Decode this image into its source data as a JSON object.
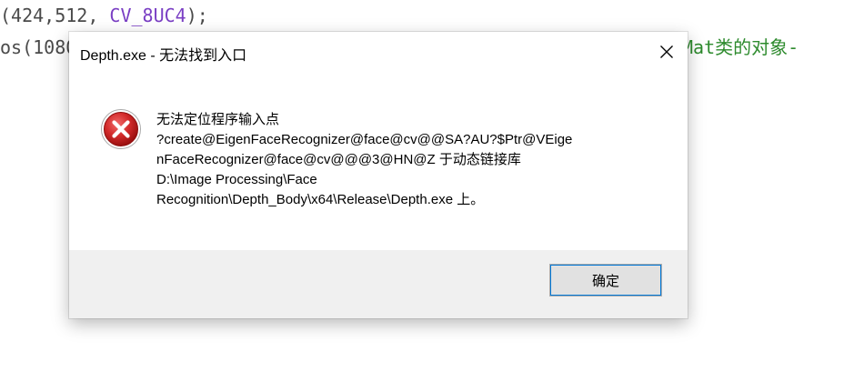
{
  "editor": {
    "line1_prefix": "(424,512, ",
    "line1_keyword": "CV_8UC4",
    "line1_suffix": ");",
    "line2_text": "os(1080",
    "line2_comment": "化Mat类的对象-"
  },
  "dialog": {
    "title": "Depth.exe - 无法找到入口",
    "close_glyph": "✕",
    "icon": "error-icon",
    "message_lines": [
      "无法定位程序输入点",
      "?create@EigenFaceRecognizer@face@cv@@SA?AU?$Ptr@VEige",
      "nFaceRecognizer@face@cv@@@3@HN@Z 于动态链接库",
      "D:\\Image Processing\\Face",
      "Recognition\\Depth_Body\\x64\\Release\\Depth.exe 上。"
    ],
    "ok_label": "确定"
  },
  "colors": {
    "error_red": "#cc1f1f",
    "focus_blue": "#0078d7",
    "footer_bg": "#f0f0f0",
    "code_purple": "#7a3fc4",
    "code_green": "#2e8b2e"
  }
}
